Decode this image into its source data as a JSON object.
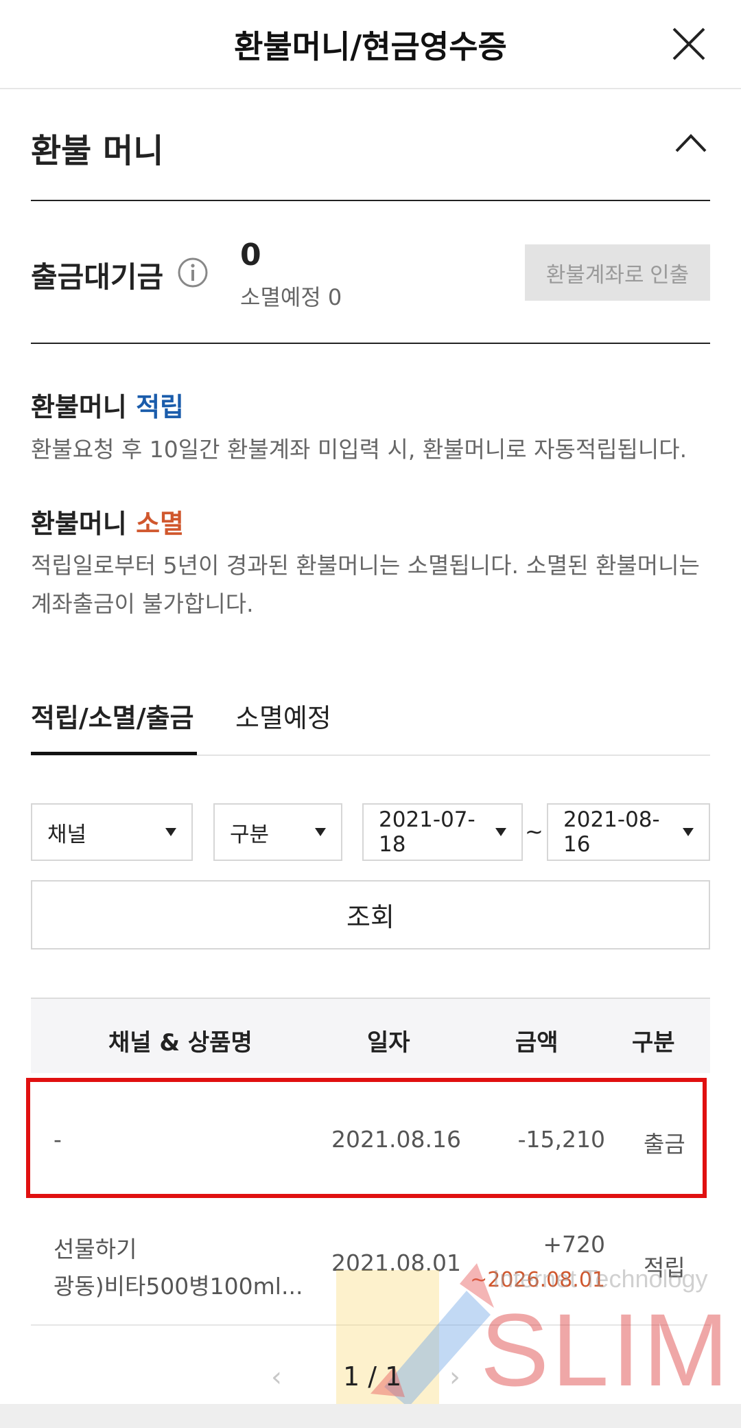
{
  "header": {
    "title": "환불머니/현금영수증"
  },
  "section": {
    "title": "환불 머니"
  },
  "pending": {
    "label": "출금대기금",
    "amount": "0",
    "expiring": "소멸예정 0",
    "withdraw_button": "환불계좌로 인출"
  },
  "info": {
    "accrual": {
      "prefix": "환불머니 ",
      "keyword": "적립",
      "desc": "환불요청 후 10일간 환불계좌 미입력 시, 환불머니로 자동적립됩니다."
    },
    "expiry": {
      "prefix": "환불머니 ",
      "keyword": "소멸",
      "desc": "적립일로부터 5년이 경과된 환불머니는 소멸됩니다. 소멸된 환불머니는 계좌출금이 불가합니다."
    }
  },
  "tabs": [
    {
      "label": "적립/소멸/출금",
      "active": true
    },
    {
      "label": "소멸예정",
      "active": false
    }
  ],
  "filters": {
    "channel": "채널",
    "type": "구분",
    "start_date": "2021-07-18",
    "tilde": "~",
    "end_date": "2021-08-16",
    "search_button": "조회"
  },
  "table": {
    "headers": [
      "채널 & 상품명",
      "일자",
      "금액",
      "구분"
    ],
    "rows": [
      {
        "product": "-",
        "date": "2021.08.16",
        "amount": "-15,210",
        "type": "출금"
      },
      {
        "product_line1": "선물하기",
        "product_line2": "광동)비타500병100ml...",
        "date": "2021.08.01",
        "amount": "+720",
        "expiry": "~2026.08.01",
        "type": "적립"
      }
    ]
  },
  "pager": {
    "prev": "‹",
    "text": "1 / 1",
    "next": "›"
  },
  "watermark": {
    "small": "Internet Technology",
    "big": "SLIM"
  },
  "colors": {
    "accrual": "#1a5cab",
    "expiry": "#d0572d",
    "highlight": "#e01010"
  },
  "icons": [
    "close-icon",
    "chevron-up-icon",
    "info-icon",
    "caret-down-icon"
  ]
}
